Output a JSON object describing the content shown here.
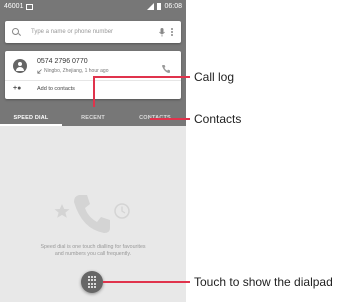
{
  "status_bar": {
    "carrier": "46001",
    "time": "06:08"
  },
  "search": {
    "placeholder": "Type a name or phone number"
  },
  "recent_call": {
    "number": "0574 2796 0770",
    "location": "Ningbo, Zhejiang, 1 hour ago",
    "add_to_contacts": "Add to contacts"
  },
  "tabs": [
    {
      "label": "SPEED DIAL",
      "active": true
    },
    {
      "label": "RECENT",
      "active": false
    },
    {
      "label": "CONTACTS",
      "active": false
    }
  ],
  "speed_dial": {
    "message": "Speed dial is one touch dialling for favourites and numbers you call frequently."
  },
  "callouts": {
    "call_log": "Call log",
    "contacts": "Contacts",
    "dialpad": "Touch to show the dialpad"
  },
  "colors": {
    "appbar": "#777777",
    "leader_line": "#e0334c",
    "fab": "#666666"
  }
}
